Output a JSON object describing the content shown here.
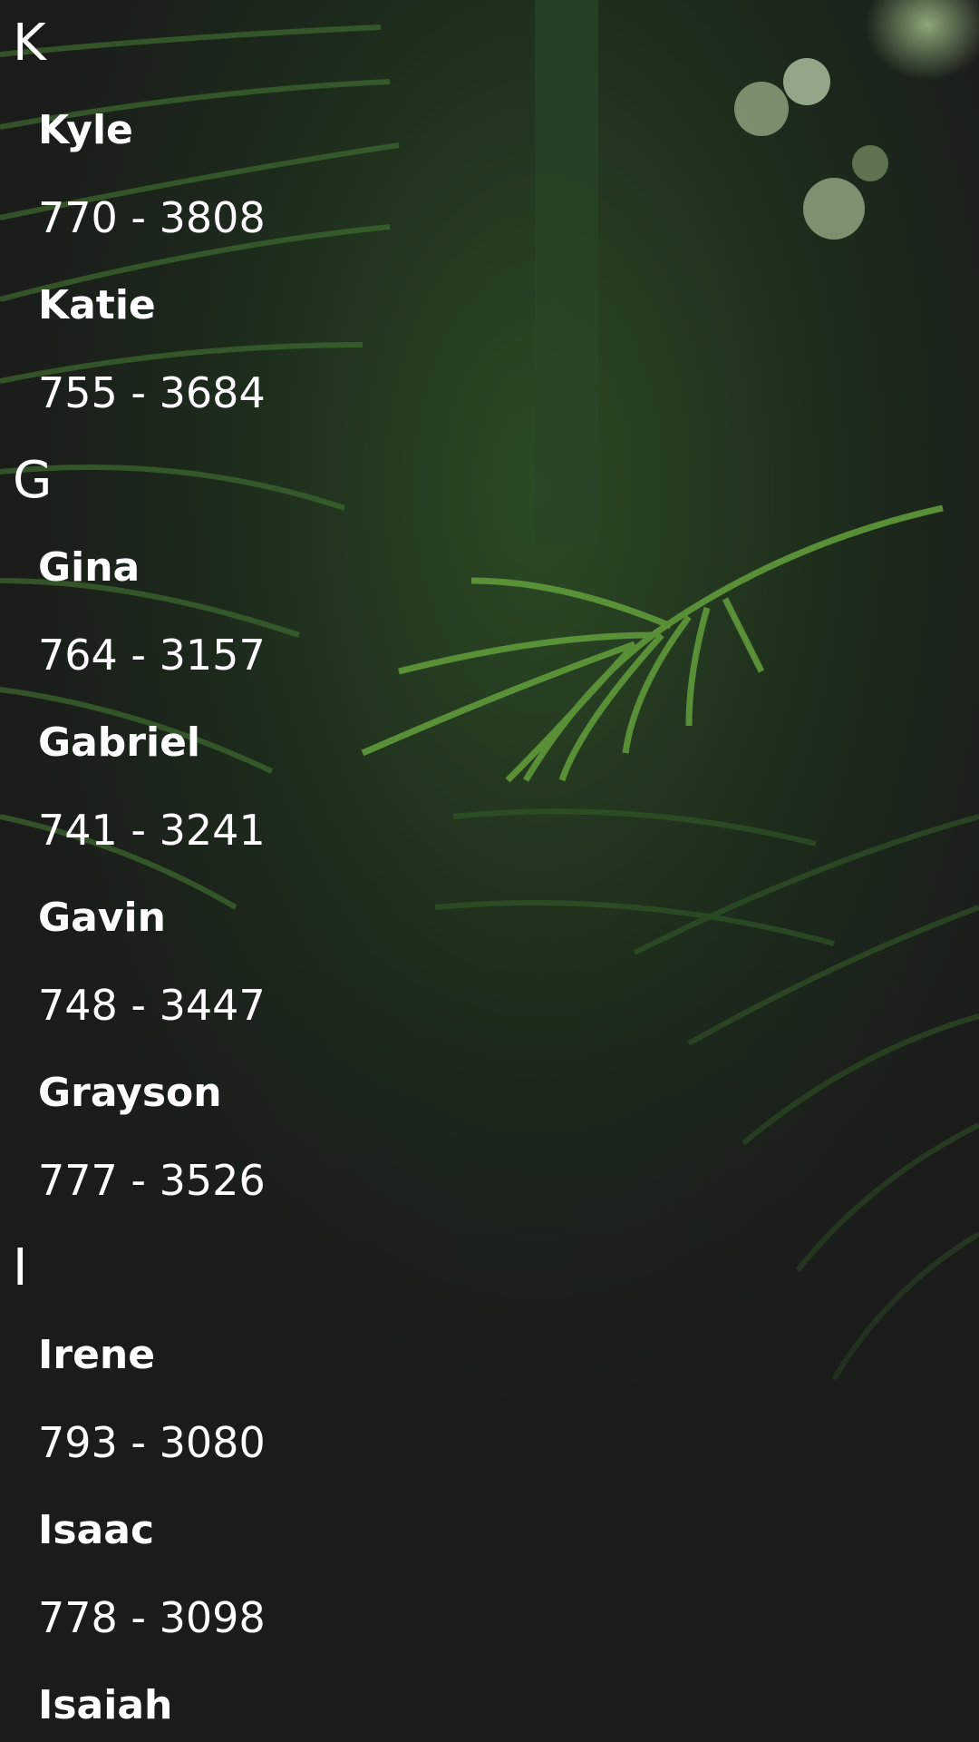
{
  "contacts": {
    "sections": [
      {
        "letter": "K",
        "items": [
          {
            "name": "Kyle",
            "phone": "770 - 3808"
          },
          {
            "name": "Katie",
            "phone": "755 - 3684"
          }
        ]
      },
      {
        "letter": "G",
        "items": [
          {
            "name": "Gina",
            "phone": "764 - 3157"
          },
          {
            "name": "Gabriel",
            "phone": "741 - 3241"
          },
          {
            "name": "Gavin",
            "phone": "748 - 3447"
          },
          {
            "name": "Grayson",
            "phone": "777 - 3526"
          }
        ]
      },
      {
        "letter": "I",
        "items": [
          {
            "name": "Irene",
            "phone": "793 - 3080"
          },
          {
            "name": "Isaac",
            "phone": "778 - 3098"
          },
          {
            "name": "Isaiah",
            "phone": ""
          }
        ]
      }
    ]
  },
  "colors": {
    "text": "#ffffff",
    "background": "#1b1d1b",
    "foliage_dark": "#1f3a1a",
    "foliage_light": "#5f9a3a"
  },
  "background_image": "jungle-palm-leaves"
}
